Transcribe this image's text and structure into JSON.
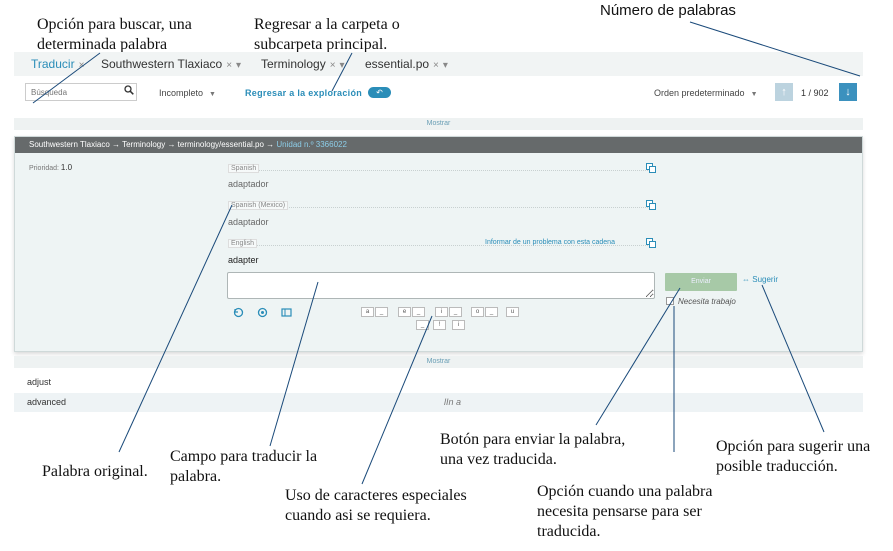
{
  "annotations": {
    "search_option": [
      "Opción para buscar, una",
      "determinada palabra"
    ],
    "back_folder": [
      "Regresar a la carpeta o",
      "subcarpeta principal."
    ],
    "word_count": "Número de palabras",
    "original_word": "Palabra original.",
    "translate_field": [
      "Campo para traducir la",
      "palabra."
    ],
    "special_chars": [
      "Uso de caracteres especiales",
      "cuando asi se requiera."
    ],
    "send_button": [
      "Botón para enviar la palabra,",
      "una vez traducida."
    ],
    "needs_work_option": [
      "Opción cuando una palabra",
      "necesita pensarse para ser",
      "traducida."
    ],
    "suggest_option": [
      "Opción para sugerir una",
      "posible traducción."
    ]
  },
  "tabs": [
    {
      "label": "Traducir"
    },
    {
      "label": "Southwestern Tlaxiaco"
    },
    {
      "label": "Terminology"
    },
    {
      "label": "essential.po"
    }
  ],
  "toolbar": {
    "search_placeholder": "Búsqueda",
    "filter_label": "Incompleto",
    "back_label": "Regresar a la exploración",
    "sort_label": "Orden predeterminado",
    "counter": "1 / 902"
  },
  "mostrar_label": "Mostrar",
  "editor": {
    "breadcrumb": "Southwestern Tlaxiaco  →  Terminology  →  terminology/essential.po  →",
    "unit": "Unidad n.º 3366022",
    "priority_label": "Prioridad:",
    "priority_value": "1.0",
    "sources": [
      {
        "language": "Spanish",
        "text": "adaptador"
      },
      {
        "language": "Spanish (Mexico)",
        "text": "adaptador"
      },
      {
        "language": "English",
        "text": "adapter"
      }
    ],
    "report_link": "Informar de un problema con esta cadena",
    "send_label": "Enviar",
    "suggest_label": "Sugerir",
    "needs_work_label": "Necesita trabajo",
    "special_chars_row1": [
      "a",
      "_",
      "e",
      "_",
      "i",
      "_",
      "o",
      "_",
      "u"
    ],
    "special_chars_row2": [
      "_",
      "!",
      "i"
    ]
  },
  "rows": [
    {
      "term": "adjust",
      "status": ""
    },
    {
      "term": "advanced",
      "status": "lIn a"
    }
  ],
  "colors": {
    "accent": "#2a8db8",
    "send_button": "#a7c9a7",
    "breadcrumb_bar": "#666a6b",
    "panel_bg": "#eef4f4"
  }
}
